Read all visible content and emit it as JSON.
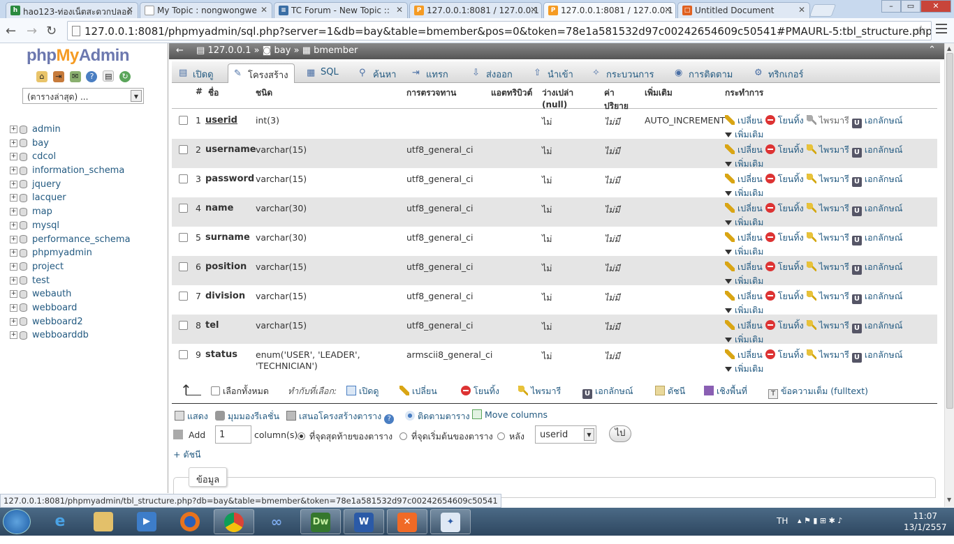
{
  "browser": {
    "tabs": [
      {
        "title": "hao123-ท่องเน็ตสะดวกปลอด",
        "favicon": "hao123"
      },
      {
        "title": "My Topic : nongwongwe",
        "favicon": "page"
      },
      {
        "title": "TC Forum - New Topic ::",
        "favicon": "forum"
      },
      {
        "title": "127.0.0.1:8081 / 127.0.0.1 /",
        "favicon": "pma"
      },
      {
        "title": "127.0.0.1:8081 / 127.0.0.1 /",
        "favicon": "pma"
      },
      {
        "title": "Untitled Document",
        "favicon": "doc"
      }
    ],
    "url": "127.0.0.1:8081/phpmyadmin/sql.php?server=1&db=bay&table=bmember&pos=0&token=78e1a581532d97c00242654609c50541#PMAURL-5:tbl_structure.php?db=bay",
    "status_url": "127.0.0.1:8081/phpmyadmin/tbl_structure.php?db=bay&table=bmember&token=78e1a581532d97c00242654609c50541"
  },
  "sidebar": {
    "logo": {
      "php": "php",
      "my": "My",
      "admin": "Admin"
    },
    "recent_select": "(ตารางล่าสุด) ...",
    "databases": [
      "admin",
      "bay",
      "cdcol",
      "information_schema",
      "jquery",
      "lacquer",
      "map",
      "mysql",
      "performance_schema",
      "phpmyadmin",
      "project",
      "test",
      "webauth",
      "webboard",
      "webboard2",
      "webboarddb"
    ]
  },
  "breadcrumb": {
    "server": "127.0.0.1",
    "db": "bay",
    "table": "bmember",
    "sep": "»"
  },
  "tabs": [
    {
      "label": "เปิดดู",
      "icon": "browse-icon"
    },
    {
      "label": "โครงสร้าง",
      "icon": "structure-icon"
    },
    {
      "label": "SQL",
      "icon": "sql-icon"
    },
    {
      "label": "ค้นหา",
      "icon": "search-icon"
    },
    {
      "label": "แทรก",
      "icon": "insert-icon"
    },
    {
      "label": "ส่งออก",
      "icon": "export-icon"
    },
    {
      "label": "นำเข้า",
      "icon": "import-icon"
    },
    {
      "label": "กระบวนการ",
      "icon": "operations-icon"
    },
    {
      "label": "การติดตาม",
      "icon": "tracking-icon"
    },
    {
      "label": "ทริกเกอร์",
      "icon": "triggers-icon"
    }
  ],
  "table_headers": {
    "num": "#",
    "name": "ชื่อ",
    "type": "ชนิด",
    "collation": "การตรวจทาน",
    "attributes": "แอตทริบิวต์",
    "null": "ว่างเปล่า (null)",
    "default": "ค่า ปริยาย",
    "extra": "เพิ่มเติม",
    "action": "กระทำการ"
  },
  "columns": [
    {
      "num": "1",
      "name": "userid",
      "type": "int(3)",
      "collation": "",
      "null": "ไม่",
      "default": "ไม่มี",
      "extra": "AUTO_INCREMENT",
      "primary": true
    },
    {
      "num": "2",
      "name": "username",
      "type": "varchar(15)",
      "collation": "utf8_general_ci",
      "null": "ไม่",
      "default": "ไม่มี",
      "extra": "",
      "primary": false
    },
    {
      "num": "3",
      "name": "password",
      "type": "varchar(15)",
      "collation": "utf8_general_ci",
      "null": "ไม่",
      "default": "ไม่มี",
      "extra": "",
      "primary": false
    },
    {
      "num": "4",
      "name": "name",
      "type": "varchar(30)",
      "collation": "utf8_general_ci",
      "null": "ไม่",
      "default": "ไม่มี",
      "extra": "",
      "primary": false
    },
    {
      "num": "5",
      "name": "surname",
      "type": "varchar(30)",
      "collation": "utf8_general_ci",
      "null": "ไม่",
      "default": "ไม่มี",
      "extra": "",
      "primary": false
    },
    {
      "num": "6",
      "name": "position",
      "type": "varchar(15)",
      "collation": "utf8_general_ci",
      "null": "ไม่",
      "default": "ไม่มี",
      "extra": "",
      "primary": false
    },
    {
      "num": "7",
      "name": "division",
      "type": "varchar(15)",
      "collation": "utf8_general_ci",
      "null": "ไม่",
      "default": "ไม่มี",
      "extra": "",
      "primary": false
    },
    {
      "num": "8",
      "name": "tel",
      "type": "varchar(15)",
      "collation": "utf8_general_ci",
      "null": "ไม่",
      "default": "ไม่มี",
      "extra": "",
      "primary": false
    },
    {
      "num": "9",
      "name": "status",
      "type": "enum('USER', 'LEADER',",
      "type2": "'TECHNICIAN')",
      "collation": "armscii8_general_ci",
      "null": "ไม่",
      "default": "ไม่มี",
      "extra": "",
      "primary": false
    }
  ],
  "row_actions": {
    "change": "เปลี่ยน",
    "drop": "โยนทิ้ง",
    "primary": "ไพรมารี",
    "unique": "เอกลักษณ์",
    "more": "เพิ่มเติม"
  },
  "bulk": {
    "check_all": "เลือกทั้งหมด",
    "with_selected": "ทำกับที่เลือก:",
    "browse": "เปิดดู",
    "change": "เปลี่ยน",
    "drop": "โยนทิ้ง",
    "primary": "ไพรมารี",
    "unique": "เอกลักษณ์",
    "index": "ดัชนี",
    "spatial": "เชิงพื้นที่",
    "fulltext": "ข้อความเต็ม (fulltext)"
  },
  "links": {
    "print": "แสดง",
    "relation_view": "มุมมองรีเลชั่น",
    "propose": "เสนอโครงสร้างตาราง",
    "track": "ติดตามตาราง",
    "move_columns": "Move columns"
  },
  "add_columns": {
    "label": "Add",
    "count": "1",
    "unit": "column(s)",
    "at_end": "ที่จุดสุดท้ายของตาราง",
    "at_begin": "ที่จุดเริ่มต้นของตาราง",
    "after": "หลัง",
    "after_col": "userid",
    "go": "ไป"
  },
  "index_link": "+ ดัชนี",
  "info_legend": "ข้อมูล",
  "taskbar": {
    "lang": "TH",
    "time": "11:07",
    "date": "13/1/2557"
  }
}
